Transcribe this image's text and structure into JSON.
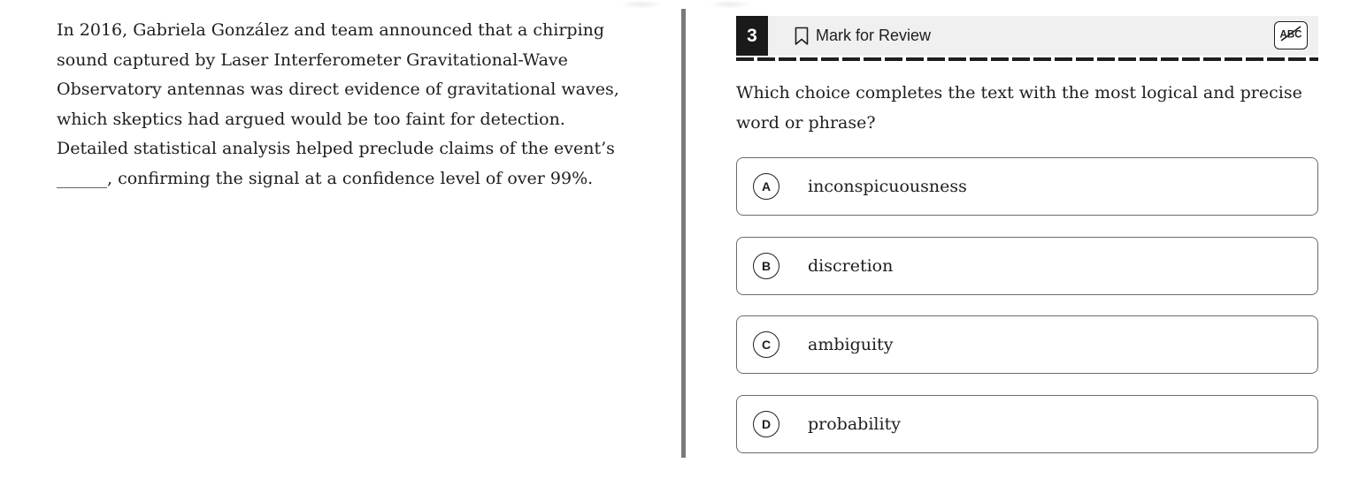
{
  "passage": {
    "text": "In 2016, Gabriela González and team announced that a chirping sound captured by Laser Interferometer Gravitational-Wave Observatory antennas was direct evidence of gravitational waves, which skeptics had argued would be too faint for detection. Detailed statistical analysis helped preclude claims of the event’s ______, confirming the signal at a confidence level of over 99%."
  },
  "question": {
    "number": "3",
    "mark_for_review_label": "Mark for Review",
    "prompt": "Which choice completes the text with the most logical and precise word or phrase?",
    "choices": [
      {
        "letter": "A",
        "text": "inconspicuousness"
      },
      {
        "letter": "B",
        "text": "discretion"
      },
      {
        "letter": "C",
        "text": "ambiguity"
      },
      {
        "letter": "D",
        "text": "probability"
      }
    ]
  },
  "toolbar": {
    "abc_label": "ABC"
  },
  "icons": {
    "bookmark": "bookmark-icon",
    "abc_strike": "abc-strikethrough-icon"
  }
}
